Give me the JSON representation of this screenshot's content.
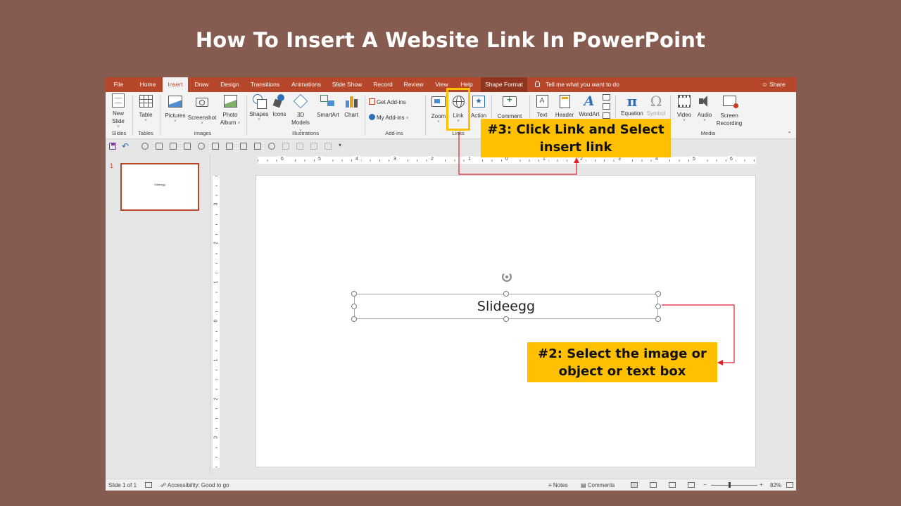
{
  "page": {
    "title": "How To Insert A Website Link In PowerPoint"
  },
  "tabs": [
    {
      "label": "File",
      "active": false
    },
    {
      "label": "Home",
      "active": false
    },
    {
      "label": "Insert",
      "active": true
    },
    {
      "label": "Draw",
      "active": false
    },
    {
      "label": "Design",
      "active": false
    },
    {
      "label": "Transitions",
      "active": false
    },
    {
      "label": "Animations",
      "active": false
    },
    {
      "label": "Slide Show",
      "active": false
    },
    {
      "label": "Record",
      "active": false
    },
    {
      "label": "Review",
      "active": false
    },
    {
      "label": "View",
      "active": false
    },
    {
      "label": "Help",
      "active": false
    },
    {
      "label": "Shape Format",
      "active": false
    }
  ],
  "tell_me": "Tell me what you want to do",
  "share": "Share",
  "ribbon": {
    "new_slide": {
      "line1": "New",
      "line2": "Slide"
    },
    "table": "Table",
    "pictures": "Pictures",
    "screenshot": "Screenshot",
    "photo_album": {
      "line1": "Photo",
      "line2": "Album"
    },
    "shapes": "Shapes",
    "icons": "Icons",
    "models_3d": {
      "line1": "3D",
      "line2": "Models"
    },
    "smartart": "SmartArt",
    "chart": "Chart",
    "get_addins": "Get Add-ins",
    "my_addins": "My Add-ins",
    "zoom": "Zoom",
    "link": "Link",
    "action": "Action",
    "comment": "Comment",
    "text": "Text",
    "header": "Header",
    "wordart": "WordArt",
    "equation": "Equation",
    "symbol": "Symbol",
    "video": "Video",
    "audio": "Audio",
    "screen_recording": {
      "line1": "Screen",
      "line2": "Recording"
    },
    "groups": {
      "slides": "Slides",
      "tables": "Tables",
      "images": "Images",
      "illustrations": "Illustrations",
      "addins": "Add-ins",
      "links": "Links",
      "media": "Media"
    }
  },
  "thumbnail": {
    "number": "1",
    "text": "Slideegg"
  },
  "ruler": {
    "h_labels": [
      "6",
      "5",
      "4",
      "3",
      "2",
      "1",
      "0",
      "1",
      "2",
      "3",
      "4",
      "5",
      "6"
    ],
    "v_labels": [
      "3",
      "2",
      "1",
      "0",
      "1",
      "2",
      "3"
    ]
  },
  "slide": {
    "textbox_text": "Slideegg"
  },
  "status": {
    "slide_info": "Slide 1 of 1",
    "accessibility": "Accessibility: Good to go",
    "notes": "Notes",
    "comments": "Comments",
    "zoom": "82%"
  },
  "annotations": {
    "step3": {
      "line1": "#3: Click Link and Select",
      "line2": "insert link"
    },
    "step2": {
      "line1": "#2: Select the image or",
      "line2": "object or text box"
    },
    "color": "#ffc000",
    "arrow_color": "#e0202a"
  }
}
